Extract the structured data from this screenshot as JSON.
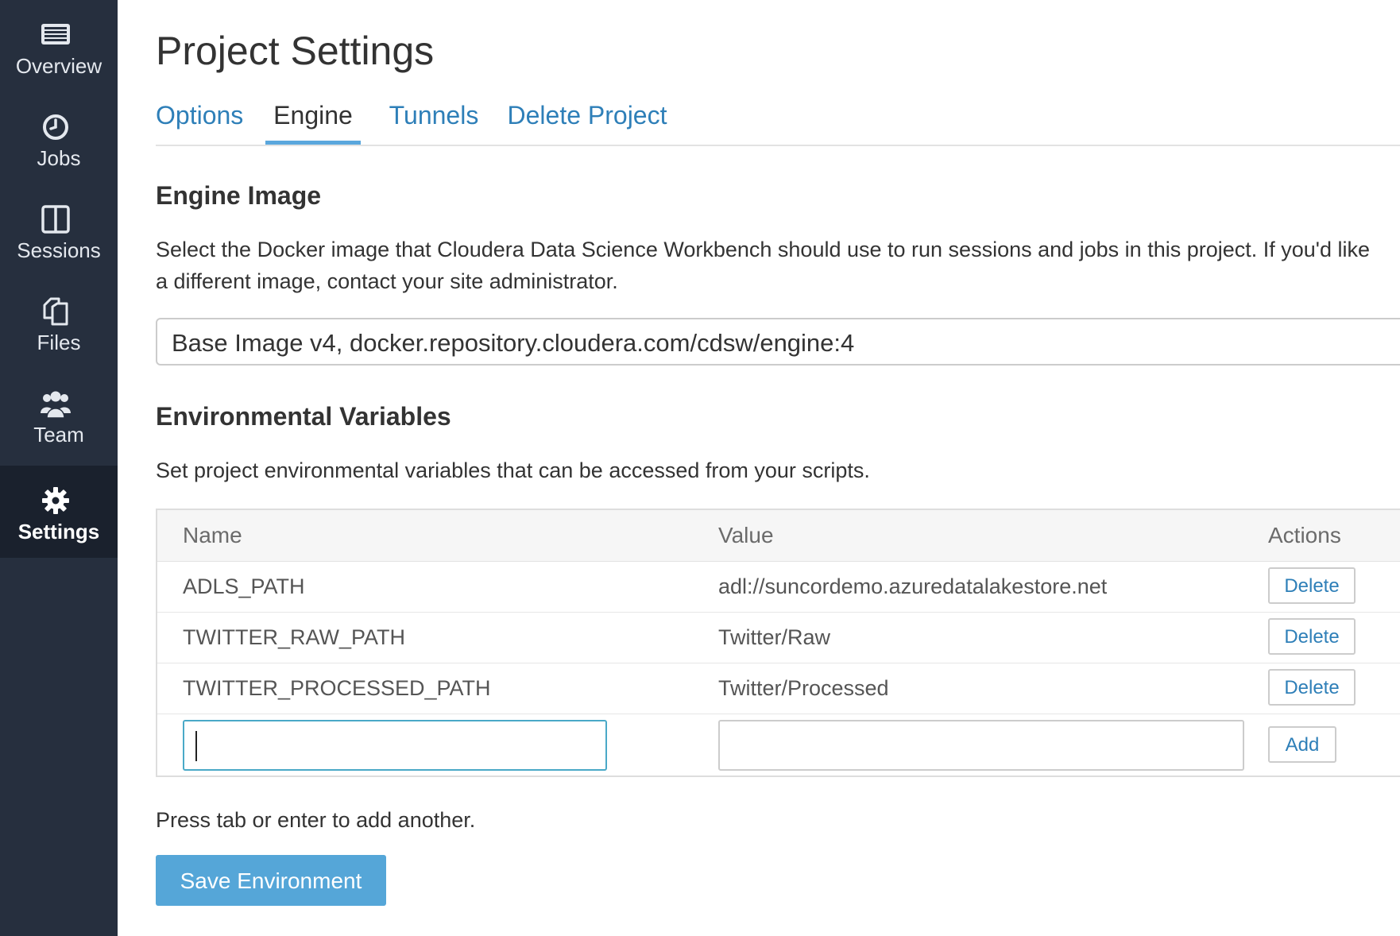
{
  "sidebar": {
    "items": [
      {
        "label": "Overview",
        "icon": "overview-icon",
        "active": false
      },
      {
        "label": "Jobs",
        "icon": "clock-icon",
        "active": false
      },
      {
        "label": "Sessions",
        "icon": "sessions-icon",
        "active": false
      },
      {
        "label": "Files",
        "icon": "files-icon",
        "active": false
      },
      {
        "label": "Team",
        "icon": "team-icon",
        "active": false
      },
      {
        "label": "Settings",
        "icon": "gear-icon",
        "active": true
      }
    ]
  },
  "page": {
    "title": "Project Settings"
  },
  "tabs": [
    {
      "label": "Options",
      "active": false
    },
    {
      "label": "Engine",
      "active": true
    },
    {
      "label": "Tunnels",
      "active": false
    },
    {
      "label": "Delete Project",
      "active": false
    }
  ],
  "engine_image": {
    "heading": "Engine Image",
    "description_line1": "Select the Docker image that Cloudera Data Science Workbench should use to run sessions and jobs in this project. If you'd like",
    "description_line2": "a different image, contact your site administrator.",
    "selected": "Base Image v4, docker.repository.cloudera.com/cdsw/engine:4"
  },
  "env_vars": {
    "heading": "Environmental Variables",
    "description": "Set project environmental variables that can be accessed from your scripts.",
    "columns": {
      "name": "Name",
      "value": "Value",
      "actions": "Actions"
    },
    "rows": [
      {
        "name": "ADLS_PATH",
        "value": "adl://suncordemo.azuredatalakestore.net",
        "action": "Delete"
      },
      {
        "name": "TWITTER_RAW_PATH",
        "value": "Twitter/Raw",
        "action": "Delete"
      },
      {
        "name": "TWITTER_PROCESSED_PATH",
        "value": "Twitter/Processed",
        "action": "Delete"
      }
    ],
    "new_row": {
      "name_value": "",
      "value_value": "",
      "add_label": "Add"
    },
    "hint": "Press tab or enter to add another.",
    "save_label": "Save Environment"
  },
  "colors": {
    "sidebar_bg": "#262f3e",
    "sidebar_active_bg": "#1a212d",
    "link": "#2e7fb8",
    "primary_button": "#55a6d8",
    "focus_border": "#4aa9c7"
  }
}
